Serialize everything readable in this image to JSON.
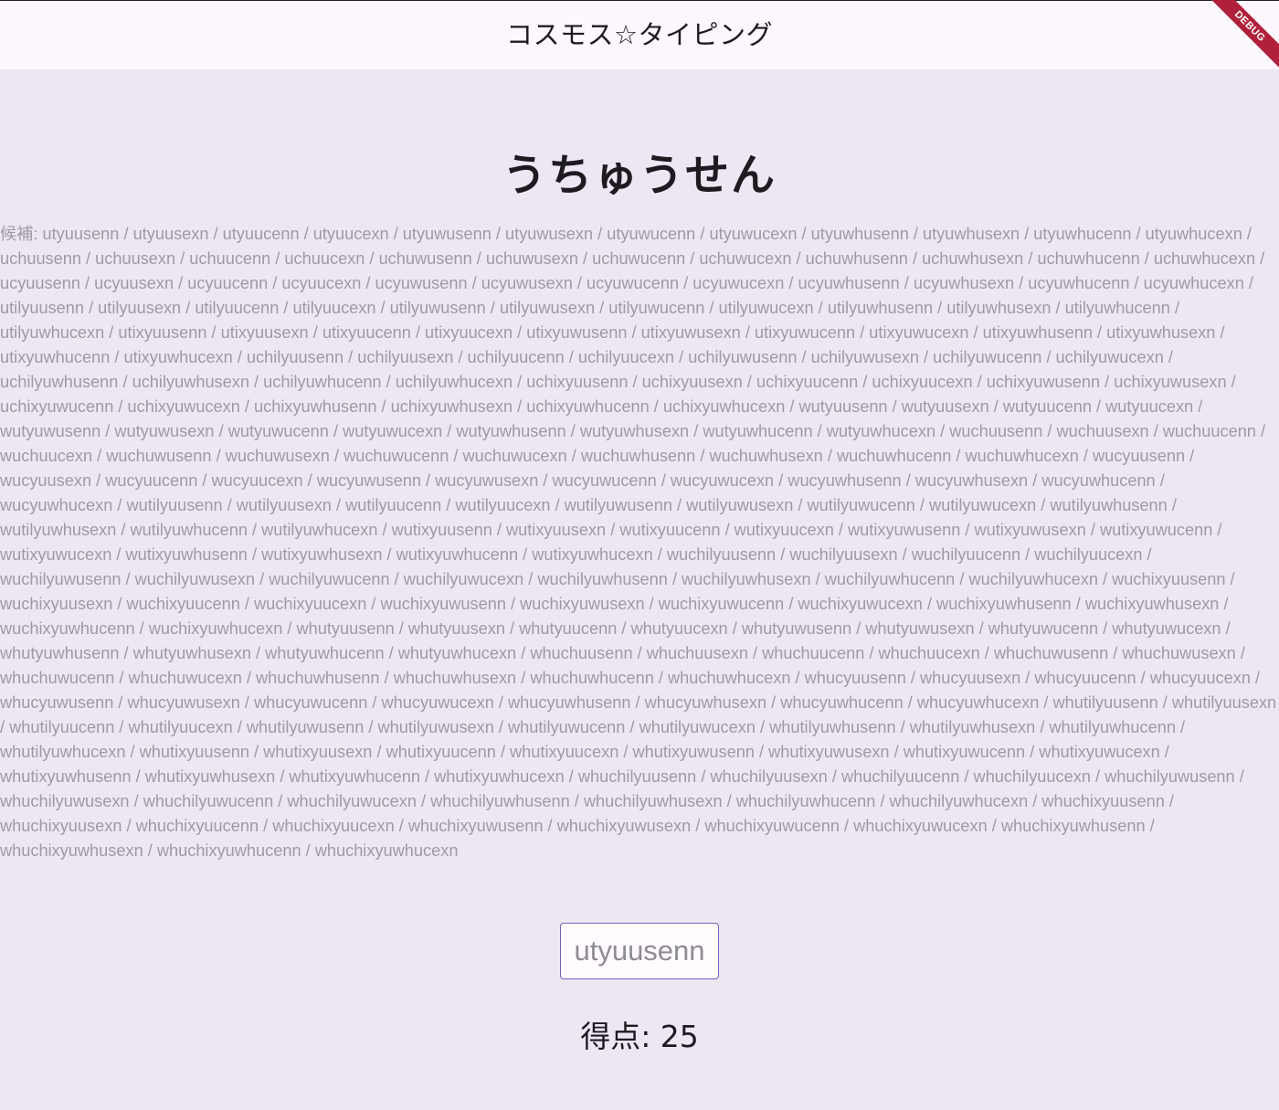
{
  "appbar": {
    "title": "コスモス☆タイピング",
    "debug_label": "DEBUG"
  },
  "main": {
    "word": "うちゅうせん",
    "candidates_text": "候補: utyuusenn / utyuusexn / utyuucenn / utyuucexn / utyuwusenn / utyuwusexn / utyuwucenn / utyuwucexn / utyuwhusenn / utyuwhusexn / utyuwhucenn / utyuwhucexn / uchuusenn / uchuusexn / uchuucenn / uchuucexn / uchuwusenn / uchuwusexn / uchuwucenn / uchuwucexn / uchuwhusenn / uchuwhusexn / uchuwhucenn / uchuwhucexn / ucyuusenn / ucyuusexn / ucyuucenn / ucyuucexn / ucyuwusenn / ucyuwusexn / ucyuwucenn / ucyuwucexn / ucyuwhusenn / ucyuwhusexn / ucyuwhucenn / ucyuwhucexn / utilyuusenn / utilyuusexn / utilyuucenn / utilyuucexn / utilyuwusenn / utilyuwusexn / utilyuwucenn / utilyuwucexn / utilyuwhusenn / utilyuwhusexn / utilyuwhucenn / utilyuwhucexn / utixyuusenn / utixyuusexn / utixyuucenn / utixyuucexn / utixyuwusenn / utixyuwusexn / utixyuwucenn / utixyuwucexn / utixyuwhusenn / utixyuwhusexn / utixyuwhucenn / utixyuwhucexn / uchilyuusenn / uchilyuusexn / uchilyuucenn / uchilyuucexn / uchilyuwusenn / uchilyuwusexn / uchilyuwucenn / uchilyuwucexn / uchilyuwhusenn / uchilyuwhusexn / uchilyuwhucenn / uchilyuwhucexn / uchixyuusenn / uchixyuusexn / uchixyuucenn / uchixyuucexn / uchixyuwusenn / uchixyuwusexn / uchixyuwucenn / uchixyuwucexn / uchixyuwhusenn / uchixyuwhusexn / uchixyuwhucenn / uchixyuwhucexn / wutyuusenn / wutyuusexn / wutyuucenn / wutyuucexn / wutyuwusenn / wutyuwusexn / wutyuwucenn / wutyuwucexn / wutyuwhusenn / wutyuwhusexn / wutyuwhucenn / wutyuwhucexn / wuchuusenn / wuchuusexn / wuchuucenn / wuchuucexn / wuchuwusenn / wuchuwusexn / wuchuwucenn / wuchuwucexn / wuchuwhusenn / wuchuwhusexn / wuchuwhucenn / wuchuwhucexn / wucyuusenn / wucyuusexn / wucyuucenn / wucyuucexn / wucyuwusenn / wucyuwusexn / wucyuwucenn / wucyuwucexn / wucyuwhusenn / wucyuwhusexn / wucyuwhucenn / wucyuwhucexn / wutilyuusenn / wutilyuusexn / wutilyuucenn / wutilyuucexn / wutilyuwusenn / wutilyuwusexn / wutilyuwucenn / wutilyuwucexn / wutilyuwhusenn / wutilyuwhusexn / wutilyuwhucenn / wutilyuwhucexn / wutixyuusenn / wutixyuusexn / wutixyuucenn / wutixyuucexn / wutixyuwusenn / wutixyuwusexn / wutixyuwucenn / wutixyuwucexn / wutixyuwhusenn / wutixyuwhusexn / wutixyuwhucenn / wutixyuwhucexn / wuchilyuusenn / wuchilyuusexn / wuchilyuucenn / wuchilyuucexn / wuchilyuwusenn / wuchilyuwusexn / wuchilyuwucenn / wuchilyuwucexn / wuchilyuwhusenn / wuchilyuwhusexn / wuchilyuwhucenn / wuchilyuwhucexn / wuchixyuusenn / wuchixyuusexn / wuchixyuucenn / wuchixyuucexn / wuchixyuwusenn / wuchixyuwusexn / wuchixyuwucenn / wuchixyuwucexn / wuchixyuwhusenn / wuchixyuwhusexn / wuchixyuwhucenn / wuchixyuwhucexn / whutyuusenn / whutyuusexn / whutyuucenn / whutyuucexn / whutyuwusenn / whutyuwusexn / whutyuwucenn / whutyuwucexn / whutyuwhusenn / whutyuwhusexn / whutyuwhucenn / whutyuwhucexn / whuchuusenn / whuchuusexn / whuchuucenn / whuchuucexn / whuchuwusenn / whuchuwusexn / whuchuwucenn / whuchuwucexn / whuchuwhusenn / whuchuwhusexn / whuchuwhucenn / whuchuwhucexn / whucyuusenn / whucyuusexn / whucyuucenn / whucyuucexn / whucyuwusenn / whucyuwusexn / whucyuwucenn / whucyuwucexn / whucyuwhusenn / whucyuwhusexn / whucyuwhucenn / whucyuwhucexn / whutilyuusenn / whutilyuusexn / whutilyuucenn / whutilyuucexn / whutilyuwusenn / whutilyuwusexn / whutilyuwucenn / whutilyuwucexn / whutilyuwhusenn / whutilyuwhusexn / whutilyuwhucenn / whutilyuwhucexn / whutixyuusenn / whutixyuusexn / whutixyuucenn / whutixyuucexn / whutixyuwusenn / whutixyuwusexn / whutixyuwucenn / whutixyuwucexn / whutixyuwhusenn / whutixyuwhusexn / whutixyuwhucenn / whutixyuwhucexn / whuchilyuusenn / whuchilyuusexn / whuchilyuucenn / whuchilyuucexn / whuchilyuwusenn / whuchilyuwusexn / whuchilyuwucenn / whuchilyuwucexn / whuchilyuwhusenn / whuchilyuwhusexn / whuchilyuwhucenn / whuchilyuwhucexn / whuchixyuusenn / whuchixyuusexn / whuchixyuucenn / whuchixyuucexn / whuchixyuwusenn / whuchixyuwusexn / whuchixyuwucenn / whuchixyuwucexn / whuchixyuwhusenn / whuchixyuwhusexn / whuchixyuwhucenn / whuchixyuwhucexn",
    "input_value": "utyuusenn",
    "score_text": "得点: 25"
  },
  "colors": {
    "background": "#ede7f4",
    "appbar": "#fdf7ff",
    "accent": "#7e5bc0",
    "debug": "#b0203a"
  }
}
